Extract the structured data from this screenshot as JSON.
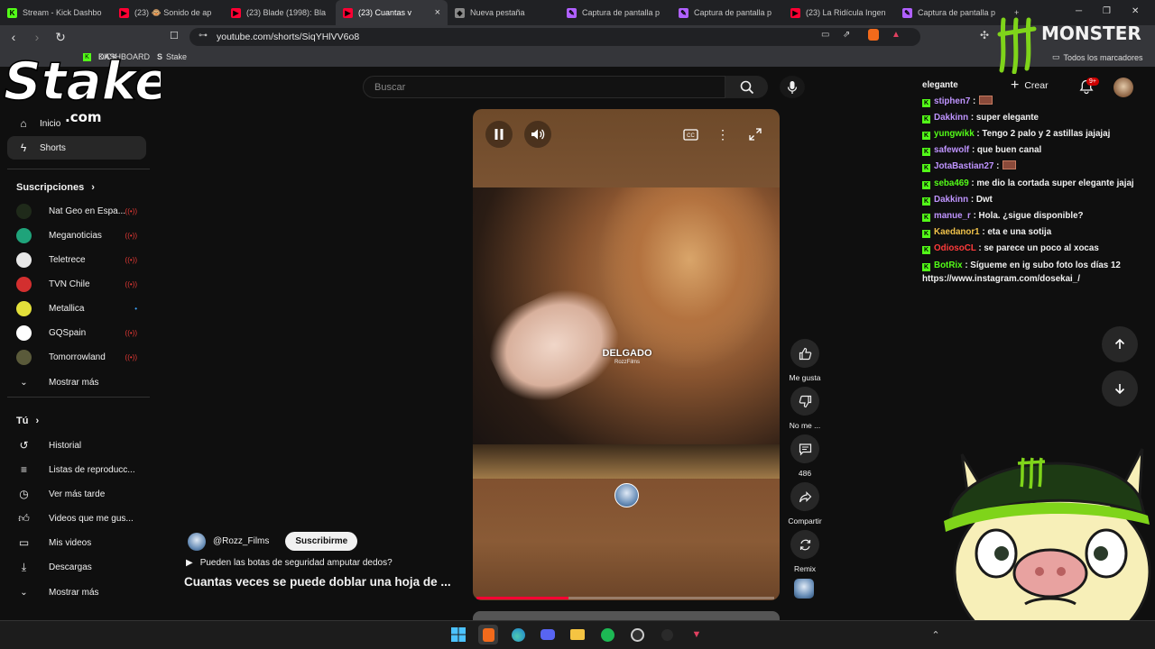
{
  "browser": {
    "tabs": [
      {
        "label": "Stream - Kick Dashbo",
        "fav": "K",
        "color": "#53fc18"
      },
      {
        "label": "(23) 🐵 Sonido de ap",
        "fav": "▶",
        "color": "#ff0033"
      },
      {
        "label": "(23) Blade (1998): Bla",
        "fav": "▶",
        "color": "#ff0033"
      },
      {
        "label": "(23) Cuantas v",
        "fav": "▶",
        "color": "#ff0033",
        "active": true
      },
      {
        "label": "Nueva pestaña",
        "fav": "◈",
        "color": "#888888"
      },
      {
        "label": "Captura de pantalla p",
        "fav": "✎",
        "color": "#b060ff"
      },
      {
        "label": "Captura de pantalla p",
        "fav": "✎",
        "color": "#b060ff"
      },
      {
        "label": "(23) La Ridícula Ingen",
        "fav": "▶",
        "color": "#ff0033"
      },
      {
        "label": "Captura de pantalla p",
        "fav": "✎",
        "color": "#b060ff"
      }
    ],
    "url": "youtube.com/shorts/SiqYHlVV6o8",
    "bookmarks": [
      "KICK",
      "DASHBOARD",
      "Stake"
    ],
    "all_bookmarks": "Todos los marcadores"
  },
  "youtube": {
    "search_placeholder": "Buscar",
    "create_label": "Crear",
    "notifications_badge": "9+",
    "sidebar": {
      "home": "Inicio",
      "shorts": "Shorts",
      "subscriptions_header": "Suscripciones",
      "subscriptions": [
        {
          "name": "Nat Geo en Espa...",
          "color": "#1f2a1a"
        },
        {
          "name": "Meganoticias",
          "color": "#1fa37a"
        },
        {
          "name": "Teletrece",
          "color": "#e8e8e8"
        },
        {
          "name": "TVN Chile",
          "color": "#d32f2f"
        },
        {
          "name": "Metallica",
          "color": "#e3e03a"
        },
        {
          "name": "GQSpain",
          "color": "#ffffff"
        },
        {
          "name": "Tomorrowland",
          "color": "#5a5a3a"
        }
      ],
      "show_more_1": "Mostrar más",
      "you_header": "Tú",
      "you_items": [
        "Historial",
        "Listas de reproducc...",
        "Ver más tarde",
        "Videos que me gus...",
        "Mis videos",
        "Descargas"
      ],
      "show_more_2": "Mostrar más"
    },
    "video": {
      "overlay_title": "DELGADO",
      "overlay_sub": "RozzFilms",
      "progress": 0.31
    },
    "actions": {
      "like": "Me gusta",
      "dislike": "No me ...",
      "comments": "486",
      "share": "Compartir",
      "remix": "Remix"
    },
    "channel": "@Rozz_Films",
    "subscribe": "Suscribirme",
    "description": "Pueden las botas de seguridad amputar dedos?",
    "title": "Cuantas veces se puede doblar una hoja de ..."
  },
  "chat": [
    {
      "user": "",
      "msg": "elegante",
      "color": "#ffffff",
      "plain": true
    },
    {
      "user": "stiphen7",
      "msg": ":",
      "color": "#bf94ff",
      "emote": true
    },
    {
      "user": "Dakkinn",
      "msg": ": super elegante",
      "color": "#bf94ff"
    },
    {
      "user": "yungwikk",
      "msg": ": Tengo 2 palo y 2 astillas jajajaj",
      "color": "#53fc18"
    },
    {
      "user": "safewolf",
      "msg": ": que buen canal",
      "color": "#bf94ff"
    },
    {
      "user": "JotaBastian27",
      "msg": ":",
      "color": "#bf94ff",
      "emote": true
    },
    {
      "user": "seba469",
      "msg": ": me dio la cortada super elegante jajaj",
      "color": "#53fc18",
      "wrap": true
    },
    {
      "user": "Dakkinn",
      "msg": ": Dwt",
      "color": "#bf94ff"
    },
    {
      "user": "manue_r",
      "msg": ": Hola. ¿sigue disponible?",
      "color": "#bf94ff"
    },
    {
      "user": "Kaedanor1",
      "msg": ": eta e una sotija",
      "color": "#f0c24a"
    },
    {
      "user": "OdiosoCL",
      "msg": ": se parece un poco al xocas",
      "color": "#ff3b3b"
    },
    {
      "user": "BotRix",
      "msg": ": Sígueme en ig subo foto los días 12 https://www.instagram.com/dosekai_/",
      "color": "#53fc18",
      "wrap": true
    }
  ],
  "overlays": {
    "stake_logo": "Stake",
    "stake_tld": ".com",
    "monster_logo": "MONSTER"
  }
}
